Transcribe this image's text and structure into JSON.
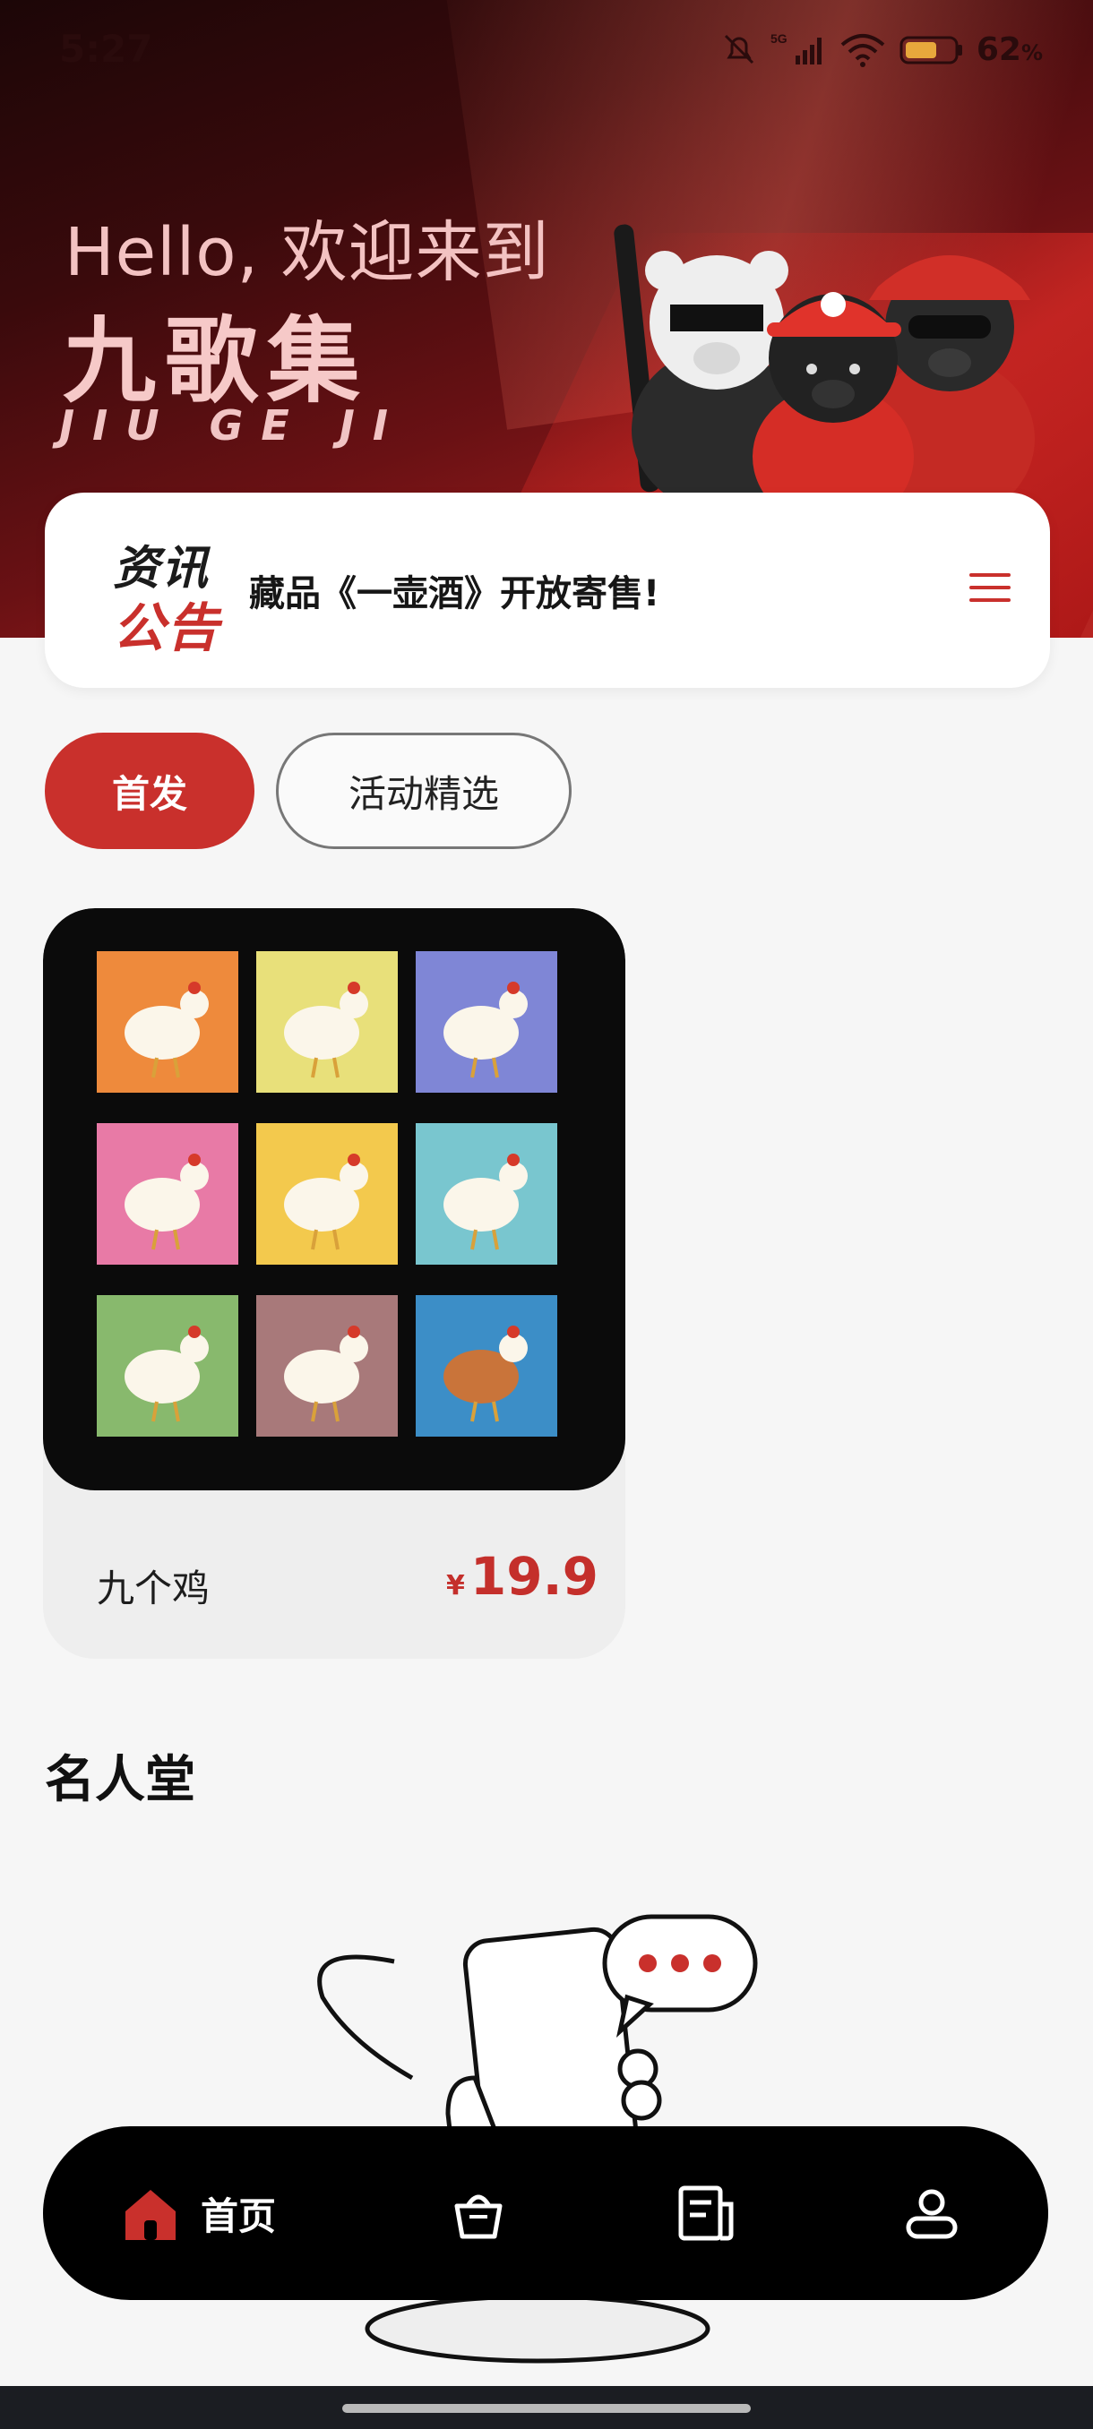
{
  "status_bar": {
    "time": "5:27",
    "network": "5G",
    "battery_percent": "62",
    "battery_unit": "%"
  },
  "hero": {
    "line1": "Hello, 欢迎来到",
    "line2": "九歌集",
    "line3": "JIU GE JI"
  },
  "notice": {
    "logo_top": "资讯",
    "logo_bottom": "公告",
    "text": "藏品《一壶酒》开放寄售!",
    "menu_icon": "menu-icon"
  },
  "tabs": [
    {
      "label": "首发",
      "active": true
    },
    {
      "label": "活动精选",
      "active": false
    }
  ],
  "product": {
    "name": "九个鸡",
    "currency": "¥",
    "price": "19.9",
    "tiles": [
      "#ee8a3c",
      "#e8e07a",
      "#7f86d6",
      "#e87aa6",
      "#f3c94d",
      "#79c6cf",
      "#88b96d",
      "#a8797a",
      "#3c8ec7"
    ]
  },
  "hall_of_fame": {
    "title": "名人堂"
  },
  "bottom_nav": {
    "items": [
      {
        "label": "首页",
        "icon": "home-icon",
        "active": true
      },
      {
        "label": "",
        "icon": "shopping-bag-icon",
        "active": false
      },
      {
        "label": "",
        "icon": "news-icon",
        "active": false
      },
      {
        "label": "",
        "icon": "profile-icon",
        "active": false
      }
    ]
  },
  "colors": {
    "accent": "#c9302c",
    "nav_bg": "#000000",
    "page_bg": "#f6f6f6"
  }
}
